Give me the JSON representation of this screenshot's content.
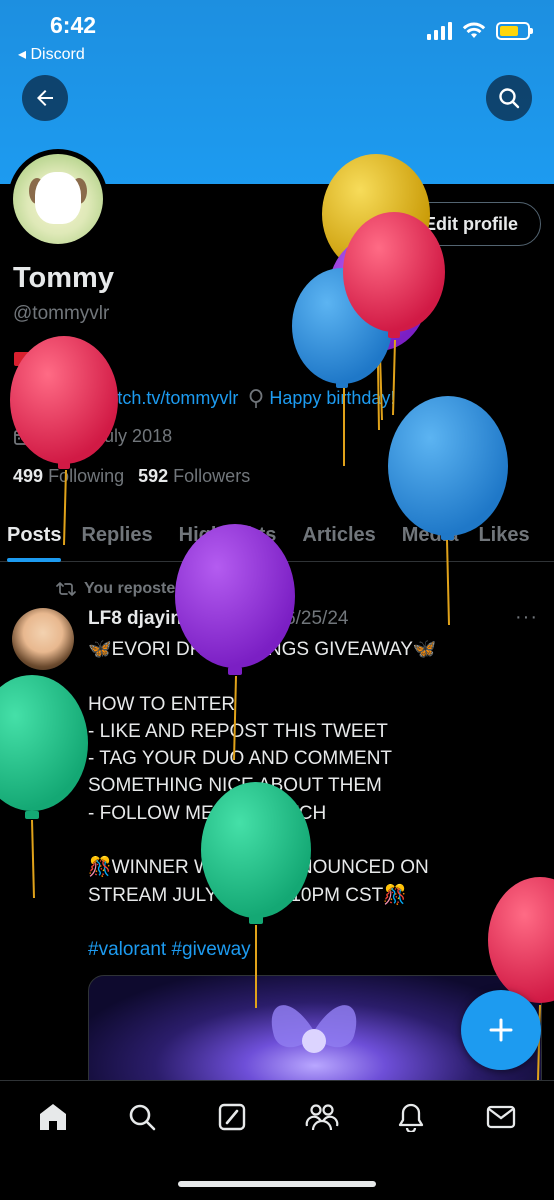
{
  "status_bar": {
    "time": "6:42",
    "back_app": "◂ Discord"
  },
  "profile": {
    "display_name": "Tommy",
    "handle": "@tommyvlr",
    "edit_button": "Edit profile",
    "location": "WA",
    "website": "twitch.tv/tommyvlr",
    "birthday": "Happy birthday!",
    "joined": "Joined July 2018",
    "following_count": "499",
    "following_label": "Following",
    "followers_count": "592",
    "followers_label": "Followers"
  },
  "tabs": [
    "Posts",
    "Replies",
    "Highlights",
    "Articles",
    "Media",
    "Likes"
  ],
  "post": {
    "repost_label": "You reposted",
    "author": "LF8 djayin",
    "handle": "@djayin_",
    "date": "· 6/25/24",
    "more": "···",
    "lines": [
      "🦋EVORI DREAMWINGS GIVEAWAY🦋",
      "",
      "HOW TO ENTER",
      "- LIKE AND REPOST THIS TWEET",
      "- TAG YOUR DUO AND COMMENT",
      "SOMETHING NICE ABOUT THEM",
      "- FOLLOW ME ON TWITCH",
      "",
      "🎊WINNER WILL BE ANNOUNCED ON",
      "STREAM JULY 5TH AT 10PM CST🎊"
    ],
    "hashtags": "#valorant #giveway"
  },
  "colors": {
    "accent": "#1d9bf0",
    "background": "#000000",
    "secondary_text": "#71767b"
  },
  "icons": {
    "back": "arrow-left-icon",
    "search": "search-icon",
    "fab": "plus-icon",
    "nav": [
      "home-icon",
      "search-icon",
      "grok-icon",
      "communities-icon",
      "notifications-icon",
      "messages-icon"
    ]
  }
}
